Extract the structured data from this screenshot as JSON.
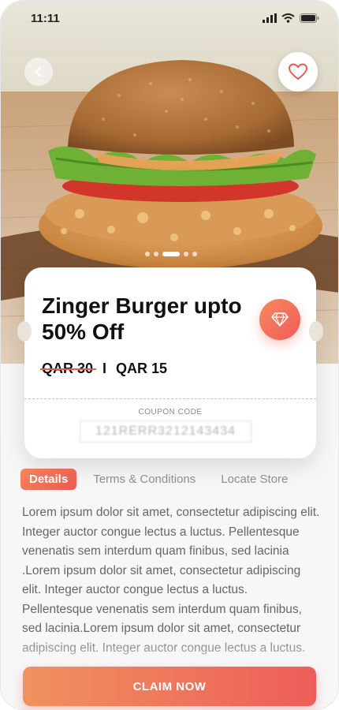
{
  "status_bar": {
    "time": "11:11",
    "icons": [
      "signal-icon",
      "wifi-icon",
      "battery-icon"
    ]
  },
  "hero": {
    "image": "zinger-burger-photo",
    "carousel_pages": 5,
    "active_page": 3
  },
  "offer": {
    "title": "Zinger Burger upto 50% Off",
    "old_price": "QAR 30",
    "separator": "I",
    "new_price": "QAR 15",
    "coupon_label": "COUPON CODE",
    "coupon_code": "121RERR3212143434"
  },
  "tabs": [
    {
      "label": "Details",
      "active": true
    },
    {
      "label": "Terms & Conditions",
      "active": false
    },
    {
      "label": "Locate Store",
      "active": false
    }
  ],
  "details_text": "Lorem ipsum dolor sit amet, consectetur adipiscing elit. Integer auctor congue lectus a luctus. Pellentesque venenatis sem interdum quam finibus, sed lacinia .Lorem ipsum dolor sit amet, consectetur adipiscing elit. Integer auctor congue lectus a luctus. Pellentesque venenatis sem interdum quam finibus, sed lacinia.Lorem ipsum dolor sit amet, consectetur adipiscing elit. Integer auctor congue lectus a luctus.",
  "cta": {
    "label": "CLAIM NOW"
  },
  "colors": {
    "accent_start": "#f5845c",
    "accent_end": "#ec5a4f",
    "text_dark": "#111111",
    "text_muted": "#8c8c9a"
  }
}
